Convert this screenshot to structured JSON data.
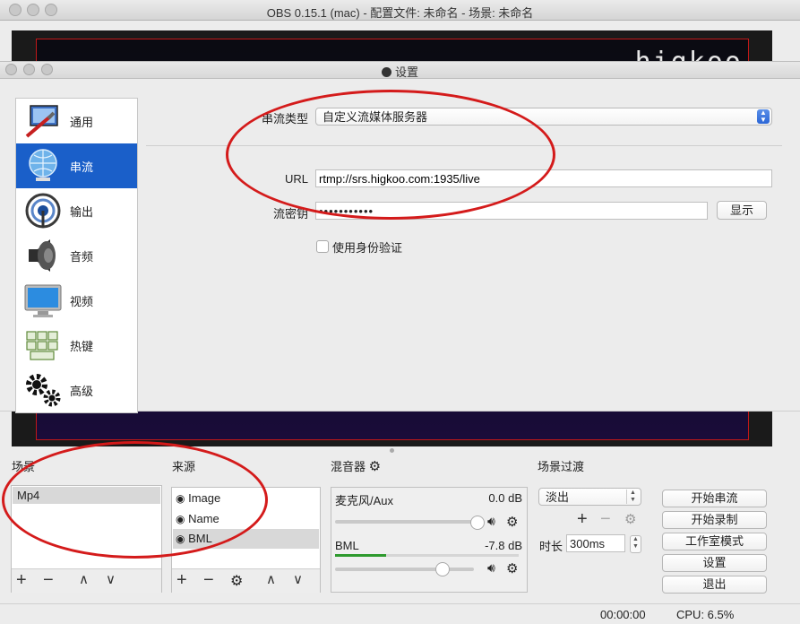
{
  "window": {
    "title": "OBS 0.15.1 (mac) - 配置文件: 未命名 - 场景: 未命名"
  },
  "preview": {
    "logo_text": "higkoo"
  },
  "settings": {
    "title": "设置",
    "sidebar": [
      {
        "label": "通用",
        "icon": "general-icon"
      },
      {
        "label": "串流",
        "icon": "stream-globe-icon"
      },
      {
        "label": "输出",
        "icon": "output-broadcast-icon"
      },
      {
        "label": "音频",
        "icon": "speaker-icon"
      },
      {
        "label": "视频",
        "icon": "monitor-icon"
      },
      {
        "label": "热键",
        "icon": "hotkeys-icon"
      },
      {
        "label": "高级",
        "icon": "gears-icon"
      }
    ],
    "stream_type_label": "串流类型",
    "stream_type_value": "自定义流媒体服务器",
    "url_label": "URL",
    "url_value": "rtmp://srs.higkoo.com:1935/live",
    "key_label": "流密钥",
    "key_value": "•••••••••••",
    "show_button": "显示",
    "auth_label": "使用身份验证"
  },
  "scenes": {
    "title": "场景",
    "items": [
      "Mp4"
    ]
  },
  "sources": {
    "title": "来源",
    "items": [
      "Image",
      "Name",
      "BML"
    ]
  },
  "mixer": {
    "title": "混音器",
    "channels": [
      {
        "name": "麦克风/Aux",
        "db": "0.0 dB",
        "level": 0.0,
        "volume": 1.0
      },
      {
        "name": "BML",
        "db": "-7.8 dB",
        "level": 0.28,
        "volume": 0.7
      }
    ]
  },
  "transitions": {
    "title": "场景过渡",
    "selected": "淡出",
    "duration_label": "时长",
    "duration_value": "300ms"
  },
  "controls": [
    "开始串流",
    "开始录制",
    "工作室模式",
    "设置",
    "退出"
  ],
  "status": {
    "time": "00:00:00",
    "cpu": "CPU: 6.5%"
  },
  "colors": {
    "accent": "#1a5fc9",
    "annotation": "#d41b1b"
  }
}
